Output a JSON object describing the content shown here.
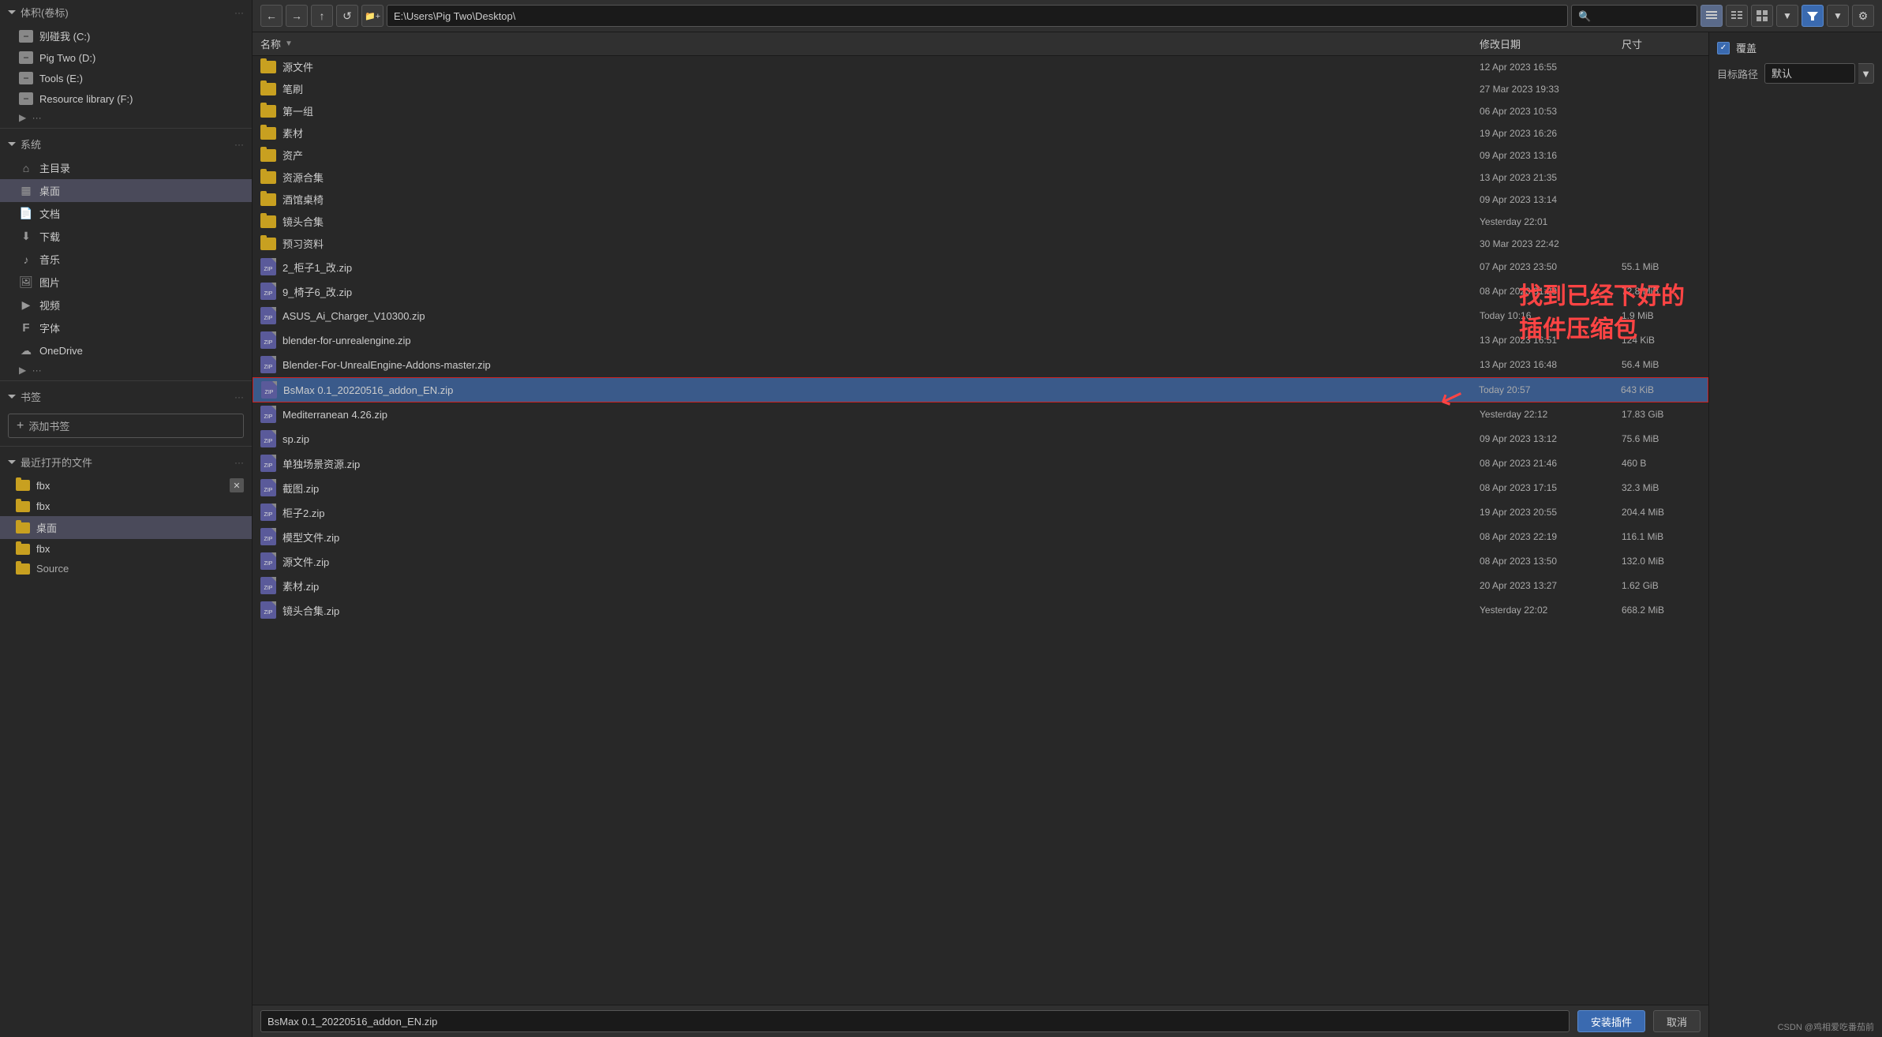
{
  "sidebar": {
    "volumes_section": "体积(卷标)",
    "volumes_dots": "···",
    "drives": [
      {
        "label": "别碰我 (C:)",
        "icon": "hdd"
      },
      {
        "label": "Pig Two (D:)",
        "icon": "hdd"
      },
      {
        "label": "Tools (E:)",
        "icon": "hdd"
      },
      {
        "label": "Resource library (F:)",
        "icon": "hdd"
      }
    ],
    "system_section": "系统",
    "system_dots": "···",
    "system_items": [
      {
        "label": "主目录",
        "icon": "home"
      },
      {
        "label": "桌面",
        "icon": "desktop",
        "active": true
      },
      {
        "label": "文档",
        "icon": "document"
      },
      {
        "label": "下载",
        "icon": "download"
      },
      {
        "label": "音乐",
        "icon": "music"
      },
      {
        "label": "图片",
        "icon": "image"
      },
      {
        "label": "视频",
        "icon": "video"
      },
      {
        "label": "字体",
        "icon": "font"
      },
      {
        "label": "OneDrive",
        "icon": "cloud"
      }
    ],
    "bookmarks_section": "书签",
    "bookmarks_dots": "···",
    "add_bookmark_label": "添加书签",
    "recent_section": "最近打开的文件",
    "recent_dots": "···",
    "recent_items": [
      {
        "label": "fbx",
        "icon": "folder",
        "has_close": true
      },
      {
        "label": "fbx",
        "icon": "folder"
      },
      {
        "label": "桌面",
        "icon": "folder",
        "active": true
      },
      {
        "label": "fbx",
        "icon": "folder"
      },
      {
        "label": "Source",
        "icon": "folder"
      }
    ]
  },
  "toolbar": {
    "back_tooltip": "后退",
    "forward_tooltip": "前进",
    "up_tooltip": "上级目录",
    "refresh_tooltip": "刷新",
    "new_folder_tooltip": "新建文件夹",
    "address": "E:\\Users\\Pig Two\\Desktop\\",
    "search_placeholder": "🔍"
  },
  "columns": {
    "name": "名称",
    "sort_icon": "▼",
    "date": "修改日期",
    "size": "尺寸"
  },
  "files": [
    {
      "name": "源文件",
      "type": "folder",
      "date": "12 Apr 2023 16:55",
      "size": ""
    },
    {
      "name": "笔刷",
      "type": "folder",
      "date": "27 Mar 2023 19:33",
      "size": ""
    },
    {
      "name": "第一组",
      "type": "folder",
      "date": "06 Apr 2023 10:53",
      "size": ""
    },
    {
      "name": "素材",
      "type": "folder",
      "date": "19 Apr 2023 16:26",
      "size": ""
    },
    {
      "name": "资产",
      "type": "folder",
      "date": "09 Apr 2023 13:16",
      "size": ""
    },
    {
      "name": "资源合集",
      "type": "folder",
      "date": "13 Apr 2023 21:35",
      "size": ""
    },
    {
      "name": "酒馆桌椅",
      "type": "folder",
      "date": "09 Apr 2023 13:14",
      "size": ""
    },
    {
      "name": "镜头合集",
      "type": "folder",
      "date": "Yesterday 22:01",
      "size": ""
    },
    {
      "name": "预习资料",
      "type": "folder",
      "date": "30 Mar 2023 22:42",
      "size": ""
    },
    {
      "name": "2_柜子1_改.zip",
      "type": "zip",
      "date": "07 Apr 2023 23:50",
      "size": "55.1 MiB"
    },
    {
      "name": "9_椅子6_改.zip",
      "type": "zip",
      "date": "08 Apr 2023 01:29",
      "size": "72.8 MiB"
    },
    {
      "name": "ASUS_Ai_Charger_V10300.zip",
      "type": "zip",
      "date": "Today 10:16",
      "size": "1.9 MiB"
    },
    {
      "name": "blender-for-unrealengine.zip",
      "type": "zip",
      "date": "13 Apr 2023 16:51",
      "size": "124 KiB"
    },
    {
      "name": "Blender-For-UnrealEngine-Addons-master.zip",
      "type": "zip",
      "date": "13 Apr 2023 16:48",
      "size": "56.4 MiB"
    },
    {
      "name": "BsMax 0.1_20220516_addon_EN.zip",
      "type": "zip",
      "date": "Today 20:57",
      "size": "643 KiB",
      "selected": true
    },
    {
      "name": "Mediterranean 4.26.zip",
      "type": "zip",
      "date": "Yesterday 22:12",
      "size": "17.83 GiB"
    },
    {
      "name": "sp.zip",
      "type": "zip",
      "date": "09 Apr 2023 13:12",
      "size": "75.6 MiB"
    },
    {
      "name": "单独场景资源.zip",
      "type": "zip",
      "date": "08 Apr 2023 21:46",
      "size": "460 B"
    },
    {
      "name": "截图.zip",
      "type": "zip",
      "date": "08 Apr 2023 17:15",
      "size": "32.3 MiB"
    },
    {
      "name": "柜子2.zip",
      "type": "zip",
      "date": "19 Apr 2023 20:55",
      "size": "204.4 MiB"
    },
    {
      "name": "模型文件.zip",
      "type": "zip",
      "date": "08 Apr 2023 22:19",
      "size": "116.1 MiB"
    },
    {
      "name": "源文件.zip",
      "type": "zip",
      "date": "08 Apr 2023 13:50",
      "size": "132.0 MiB"
    },
    {
      "name": "素材.zip",
      "type": "zip",
      "date": "20 Apr 2023 13:27",
      "size": "1.62 GiB"
    },
    {
      "name": "镜头合集.zip",
      "type": "zip",
      "date": "Yesterday 22:02",
      "size": "668.2 MiB"
    }
  ],
  "bottom": {
    "filename": "BsMax 0.1_20220516_addon_EN.zip",
    "install_label": "安装插件",
    "cancel_label": "取消"
  },
  "options": {
    "cover_label": "覆盖",
    "cover_checked": true,
    "target_path_label": "目标路径",
    "target_value": "默认",
    "view_buttons": [
      "list-detail",
      "list-compact",
      "grid",
      "dropdown"
    ]
  },
  "annotation": {
    "text": "找到已经下好的\n插件压缩包",
    "arrow": "↙"
  },
  "watermark": "CSDN @鸡相爱吃番茄前"
}
